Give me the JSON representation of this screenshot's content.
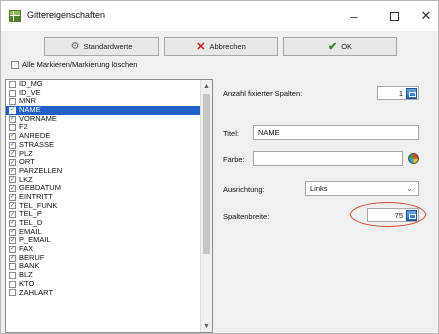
{
  "window": {
    "title": "Gittereigenschaften",
    "minimize": "–",
    "close": "✕"
  },
  "toolbar": {
    "defaults_label": "Standardwerte",
    "cancel_label": "Abbrechen",
    "ok_label": "OK"
  },
  "clear_all": {
    "label": "Alle Markieren/Markierung löschen",
    "checked": false
  },
  "columns": [
    {
      "name": "ID_MG",
      "checked": false
    },
    {
      "name": "ID_VE",
      "checked": false
    },
    {
      "name": "MNR",
      "checked": false
    },
    {
      "name": "NAME",
      "checked": true,
      "selected": true
    },
    {
      "name": "VORNAME",
      "checked": true
    },
    {
      "name": "F2",
      "checked": false
    },
    {
      "name": "ANREDE",
      "checked": true
    },
    {
      "name": "STRASSE",
      "checked": true
    },
    {
      "name": "PLZ",
      "checked": true
    },
    {
      "name": "ORT",
      "checked": true
    },
    {
      "name": "PARZELLEN",
      "checked": true
    },
    {
      "name": "LKZ",
      "checked": true
    },
    {
      "name": "GEBDATUM",
      "checked": true
    },
    {
      "name": "EINTRITT",
      "checked": true
    },
    {
      "name": "TEL_FUNK",
      "checked": true
    },
    {
      "name": "TEL_P",
      "checked": true
    },
    {
      "name": "TEL_D",
      "checked": true
    },
    {
      "name": "EMAIL",
      "checked": true
    },
    {
      "name": "P_EMAIL",
      "checked": true
    },
    {
      "name": "FAX",
      "checked": true
    },
    {
      "name": "BERUF",
      "checked": true
    },
    {
      "name": "BANK",
      "checked": false
    },
    {
      "name": "BLZ",
      "checked": false
    },
    {
      "name": "KTO",
      "checked": false
    },
    {
      "name": "ZAHLART",
      "checked": false
    }
  ],
  "properties": {
    "fixed_columns_label": "Anzahl fixierter Spalten:",
    "fixed_columns_value": "1",
    "title_label": "Titel:",
    "title_value": "NAME",
    "color_label": "Farbe:",
    "color_value": "",
    "alignment_label": "Ausrichtung:",
    "alignment_value": "Links",
    "width_label": "Spaltenbreite:",
    "width_value": "75"
  },
  "colors": {
    "selection": "#1e5fc8",
    "annotation": "#d14a2c"
  }
}
